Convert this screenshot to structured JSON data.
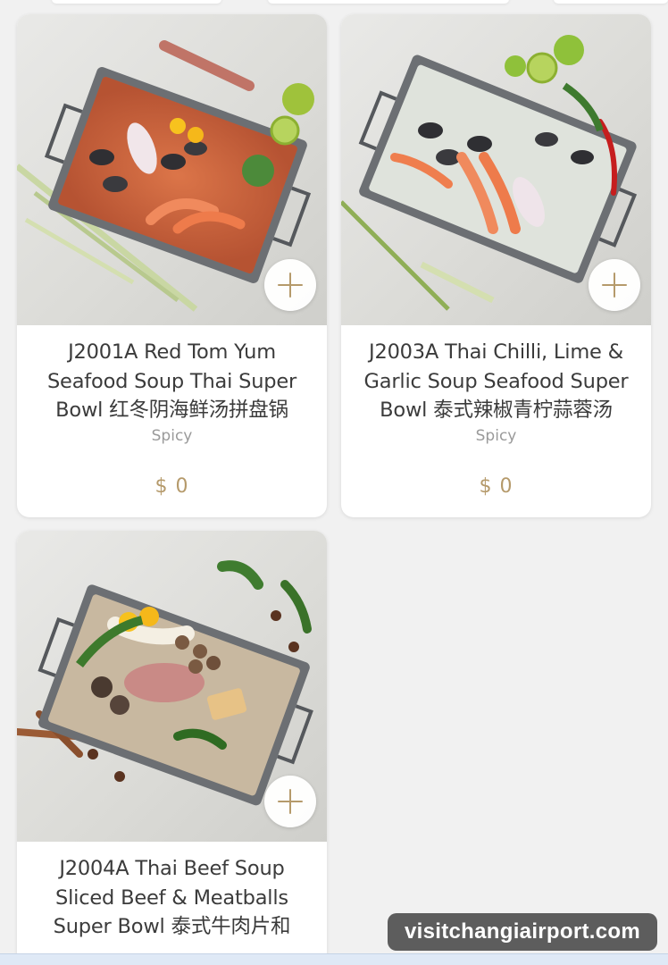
{
  "menu_items": [
    {
      "title": "J2001A Red Tom Yum Seafood Soup Thai Super Bowl 红冬阴海鲜汤拼盘锅",
      "tag": "Spicy",
      "price": "$ 0",
      "image_icon": "seafood-tom-yum-bowl"
    },
    {
      "title": "J2003A Thai Chilli, Lime & Garlic Soup Seafood Super Bowl 泰式辣椒青柠蒜蓉汤",
      "tag": "Spicy",
      "price": "$ 0",
      "image_icon": "seafood-lime-garlic-bowl"
    },
    {
      "title": "J2004A Thai Beef Soup Sliced Beef & Meatballs Super Bowl 泰式牛肉片和",
      "image_icon": "beef-soup-bowl"
    }
  ],
  "watermark": "visitchangiairport.com",
  "colors": {
    "accent": "#b59a6b",
    "background": "#f1f1f1",
    "card": "#ffffff",
    "title_text": "#3b3b3b",
    "tag_text": "#9a9a9a"
  }
}
